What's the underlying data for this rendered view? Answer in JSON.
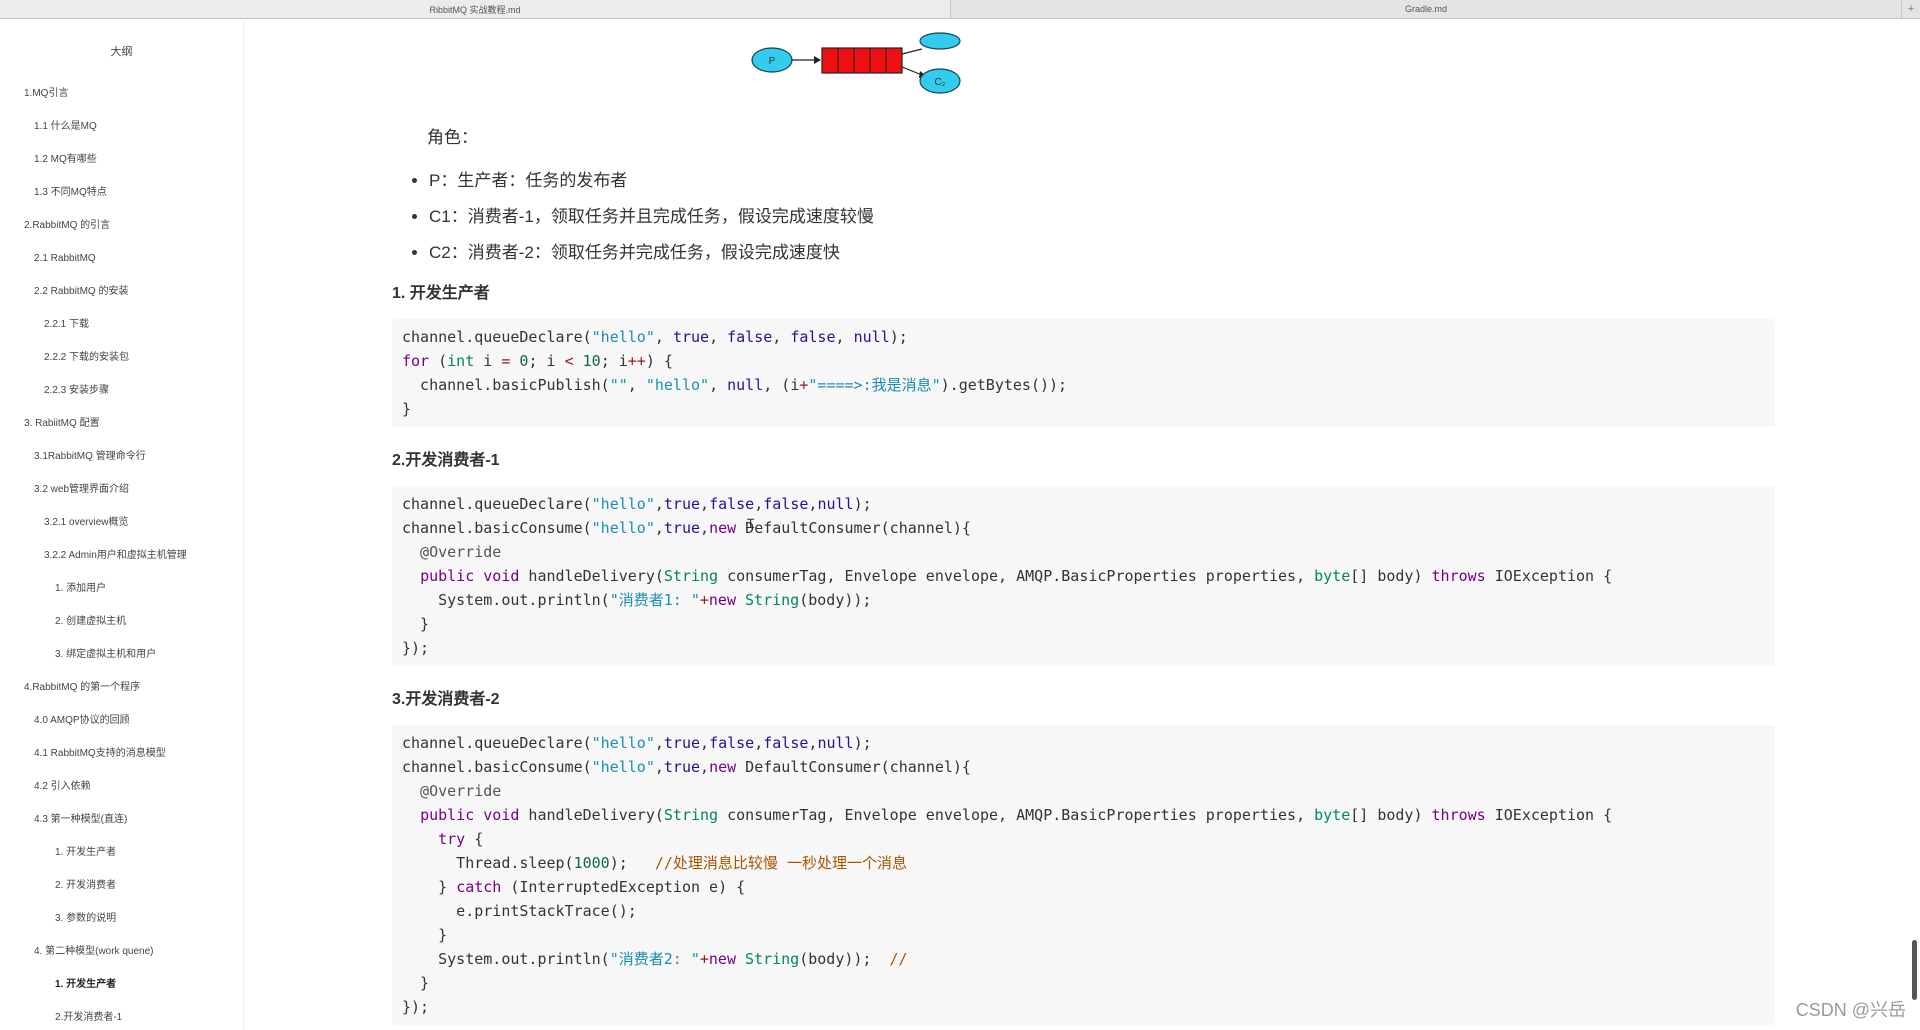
{
  "tabs": [
    "RibbitMQ 实战教程.md",
    "Gradle.md"
  ],
  "tab_add_label": "+",
  "sidebar": {
    "title": "大纲",
    "items": [
      {
        "label": "1.MQ引言",
        "level": 1
      },
      {
        "label": "1.1 什么是MQ",
        "level": 2
      },
      {
        "label": "1.2 MQ有哪些",
        "level": 2
      },
      {
        "label": "1.3 不同MQ特点",
        "level": 2
      },
      {
        "label": "2.RabbitMQ 的引言",
        "level": 1
      },
      {
        "label": "2.1 RabbitMQ",
        "level": 2
      },
      {
        "label": "2.2 RabbitMQ 的安装",
        "level": 2
      },
      {
        "label": "2.2.1 下载",
        "level": 3
      },
      {
        "label": "2.2.2 下载的安装包",
        "level": 3
      },
      {
        "label": "2.2.3 安装步骤",
        "level": 3
      },
      {
        "label": "3. RabiitMQ 配置",
        "level": 1
      },
      {
        "label": "3.1RabbitMQ 管理命令行",
        "level": 2
      },
      {
        "label": "3.2 web管理界面介绍",
        "level": 2
      },
      {
        "label": "3.2.1 overview概览",
        "level": 3
      },
      {
        "label": "3.2.2 Admin用户和虚拟主机管理",
        "level": 3
      },
      {
        "label": "1. 添加用户",
        "level": 4
      },
      {
        "label": "2. 创建虚拟主机",
        "level": 4
      },
      {
        "label": "3. 绑定虚拟主机和用户",
        "level": 4
      },
      {
        "label": "4.RabbitMQ 的第一个程序",
        "level": 1
      },
      {
        "label": "4.0 AMQP协议的回顾",
        "level": 2
      },
      {
        "label": "4.1 RabbitMQ支持的消息模型",
        "level": 2
      },
      {
        "label": "4.2 引入依赖",
        "level": 2
      },
      {
        "label": "4.3 第一种模型(直连)",
        "level": 2
      },
      {
        "label": "1. 开发生产者",
        "level": 4
      },
      {
        "label": "2. 开发消费者",
        "level": 4
      },
      {
        "label": "3. 参数的说明",
        "level": 4
      },
      {
        "label": "4. 第二种模型(work quene)",
        "level": 2
      },
      {
        "label": "1. 开发生产者",
        "level": 4,
        "active": true
      },
      {
        "label": "2.开发消费者-1",
        "level": 4
      }
    ]
  },
  "diagram": {
    "producer_label": "P",
    "consumer_label": "C₂"
  },
  "content": {
    "roles_title": "角色：",
    "roles": [
      "P：生产者：任务的发布者",
      "C1：消费者-1，领取任务并且完成任务，假设完成速度较慢",
      "C2：消费者-2：领取任务并完成任务，假设完成速度快"
    ],
    "sections": [
      {
        "heading": "1. 开发生产者",
        "code": [
          [
            [
              "",
              "channel.queueDeclare("
            ],
            [
              "str",
              "\"hello\""
            ],
            [
              "",
              ", "
            ],
            [
              "lit",
              "true"
            ],
            [
              "",
              ", "
            ],
            [
              "lit",
              "false"
            ],
            [
              "",
              ", "
            ],
            [
              "lit",
              "false"
            ],
            [
              "",
              ", "
            ],
            [
              "lit",
              "null"
            ],
            [
              "",
              ");"
            ]
          ],
          [
            [
              "kw",
              "for"
            ],
            [
              "",
              " ("
            ],
            [
              "typ",
              "int"
            ],
            [
              "",
              " i "
            ],
            [
              "op",
              "="
            ],
            [
              "",
              " "
            ],
            [
              "num",
              "0"
            ],
            [
              "",
              "; i "
            ],
            [
              "op",
              "<"
            ],
            [
              "",
              " "
            ],
            [
              "num",
              "10"
            ],
            [
              "",
              "; i"
            ],
            [
              "op",
              "++"
            ],
            [
              "",
              ") {"
            ]
          ],
          [
            [
              "",
              "  channel.basicPublish("
            ],
            [
              "str",
              "\"\""
            ],
            [
              "",
              ", "
            ],
            [
              "str",
              "\"hello\""
            ],
            [
              "",
              ", "
            ],
            [
              "lit",
              "null"
            ],
            [
              "",
              ", (i"
            ],
            [
              "op",
              "+"
            ],
            [
              "str",
              "\"====>:我是消息\""
            ],
            [
              "",
              ").getBytes());"
            ]
          ],
          [
            [
              "",
              "}"
            ]
          ]
        ]
      },
      {
        "heading": "2.开发消费者-1",
        "code": [
          [
            [
              "",
              "channel.queueDeclare("
            ],
            [
              "str",
              "\"hello\""
            ],
            [
              "",
              ","
            ],
            [
              "lit",
              "true"
            ],
            [
              "",
              ","
            ],
            [
              "lit",
              "false"
            ],
            [
              "",
              ","
            ],
            [
              "lit",
              "false"
            ],
            [
              "",
              ","
            ],
            [
              "lit",
              "null"
            ],
            [
              "",
              ");"
            ]
          ],
          [
            [
              "",
              "channel.basicConsume("
            ],
            [
              "str",
              "\"hello\""
            ],
            [
              "",
              ","
            ],
            [
              "lit",
              "true"
            ],
            [
              "",
              ","
            ],
            [
              "kw",
              "new"
            ],
            [
              "",
              " DefaultConsumer(channel){"
            ]
          ],
          [
            [
              "ann",
              "  @Override"
            ]
          ],
          [
            [
              "",
              "  "
            ],
            [
              "kw",
              "public"
            ],
            [
              "",
              " "
            ],
            [
              "kw",
              "void"
            ],
            [
              "",
              " handleDelivery("
            ],
            [
              "typ",
              "String"
            ],
            [
              "",
              " consumerTag, Envelope envelope, AMQP.BasicProperties properties, "
            ],
            [
              "typ",
              "byte"
            ],
            [
              "",
              "[] body) "
            ],
            [
              "kw",
              "throws"
            ],
            [
              "",
              " IOException {"
            ]
          ],
          [
            [
              "",
              "    System.out.println("
            ],
            [
              "str",
              "\"消费者1: \""
            ],
            [
              "op",
              "+"
            ],
            [
              "kw",
              "new"
            ],
            [
              "",
              " "
            ],
            [
              "typ",
              "String"
            ],
            [
              "",
              "(body));"
            ]
          ],
          [
            [
              "",
              "  }"
            ]
          ],
          [
            [
              "",
              "});"
            ]
          ]
        ]
      },
      {
        "heading": "3.开发消费者-2",
        "code": [
          [
            [
              "",
              "channel.queueDeclare("
            ],
            [
              "str",
              "\"hello\""
            ],
            [
              "",
              ","
            ],
            [
              "lit",
              "true"
            ],
            [
              "",
              ","
            ],
            [
              "lit",
              "false"
            ],
            [
              "",
              ","
            ],
            [
              "lit",
              "false"
            ],
            [
              "",
              ","
            ],
            [
              "lit",
              "null"
            ],
            [
              "",
              ");"
            ]
          ],
          [
            [
              "",
              "channel.basicConsume("
            ],
            [
              "str",
              "\"hello\""
            ],
            [
              "",
              ","
            ],
            [
              "lit",
              "true"
            ],
            [
              "",
              ","
            ],
            [
              "kw",
              "new"
            ],
            [
              "",
              " DefaultConsumer(channel){"
            ]
          ],
          [
            [
              "ann",
              "  @Override"
            ]
          ],
          [
            [
              "",
              "  "
            ],
            [
              "kw",
              "public"
            ],
            [
              "",
              " "
            ],
            [
              "kw",
              "void"
            ],
            [
              "",
              " handleDelivery("
            ],
            [
              "typ",
              "String"
            ],
            [
              "",
              " consumerTag, Envelope envelope, AMQP.BasicProperties properties, "
            ],
            [
              "typ",
              "byte"
            ],
            [
              "",
              "[] body) "
            ],
            [
              "kw",
              "throws"
            ],
            [
              "",
              " IOException {"
            ]
          ],
          [
            [
              "",
              "    "
            ],
            [
              "kw",
              "try"
            ],
            [
              "",
              " {"
            ]
          ],
          [
            [
              "",
              "      Thread.sleep("
            ],
            [
              "num",
              "1000"
            ],
            [
              "",
              ");   "
            ],
            [
              "cmt",
              "//处理消息比较慢 一秒处理一个消息"
            ]
          ],
          [
            [
              "",
              "    } "
            ],
            [
              "kw",
              "catch"
            ],
            [
              "",
              " (InterruptedException e) {"
            ]
          ],
          [
            [
              "",
              "      e.printStackTrace();"
            ]
          ],
          [
            [
              "",
              "    }"
            ]
          ],
          [
            [
              "",
              "    System.out.println("
            ],
            [
              "str",
              "\"消费者2: \""
            ],
            [
              "op",
              "+"
            ],
            [
              "kw",
              "new"
            ],
            [
              "",
              " "
            ],
            [
              "typ",
              "String"
            ],
            [
              "",
              "(body));  "
            ],
            [
              "cmt",
              "//"
            ]
          ],
          [
            [
              "",
              "  }"
            ]
          ],
          [
            [
              "",
              "});"
            ]
          ]
        ]
      }
    ]
  },
  "watermark": "CSDN @兴岳"
}
